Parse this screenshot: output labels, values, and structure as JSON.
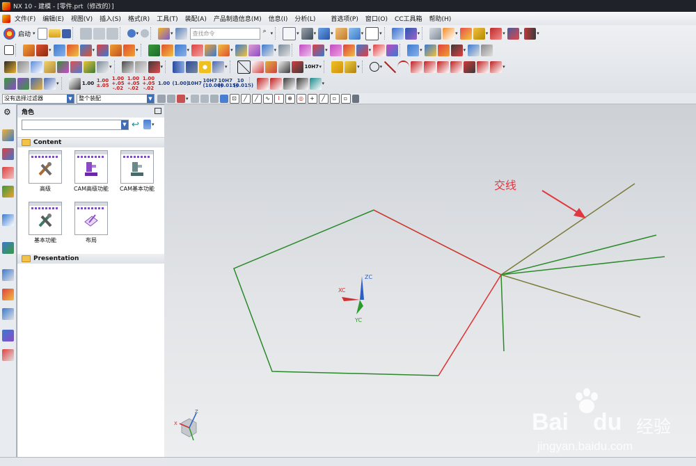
{
  "window": {
    "title": "NX 10 - 建模 - [零件.prt（修改的）]"
  },
  "menu": {
    "items": [
      "文件(F)",
      "编辑(E)",
      "视图(V)",
      "插入(S)",
      "格式(R)",
      "工具(T)",
      "装配(A)",
      "产品制造信息(M)",
      "信息(I)",
      "分析(L)",
      "首选项(P)",
      "窗口(O)",
      "CC工具箱",
      "帮助(H)"
    ]
  },
  "toolbar": {
    "start_label": "启动",
    "search_placeholder": "查找命令",
    "precision_values": [
      "1.00",
      "1.00 ±.05",
      "1.00 +.05 -.02",
      "1.00 +.05 -.02",
      "1.00 +.05 -.02",
      "1.00",
      "(1.00)",
      "10H7",
      "10H7 (10.00)",
      "10H7 (0.015)",
      "10 (0.015)"
    ],
    "precision_values_row3": [
      "10H7"
    ]
  },
  "selection_bar": {
    "filter_value": "没有选择过滤器",
    "scope_value": "整个装配"
  },
  "panel": {
    "title": "角色",
    "role_combo_value": "",
    "sections": [
      {
        "name": "Content",
        "roles": [
          {
            "label": "高级",
            "icon": "wrench-screwdriver-icon"
          },
          {
            "label": "CAM高级功能",
            "icon": "cam-machine-purple-icon"
          },
          {
            "label": "CAM基本功能",
            "icon": "cam-machine-gray-icon"
          },
          {
            "label": "基本功能",
            "icon": "wrench-screwdriver-gray-icon"
          },
          {
            "label": "布局",
            "icon": "layout-paper-icon"
          }
        ]
      },
      {
        "name": "Presentation",
        "roles": []
      }
    ]
  },
  "viewport": {
    "annotation": "交线",
    "triad_labels": {
      "x": "XC",
      "y": "YC",
      "z": "ZC"
    },
    "corner_triad_labels": {
      "x": "X",
      "z": "Z"
    },
    "colors": {
      "green_edge": "#2a8a2a",
      "red_edge": "#e03030",
      "olive_line": "#7b7a38",
      "arrow": "#e0383e"
    }
  },
  "watermark": {
    "brand": "Bai",
    "brand2": "du",
    "cn": "经验",
    "url": "jingyan.baidu.com"
  }
}
